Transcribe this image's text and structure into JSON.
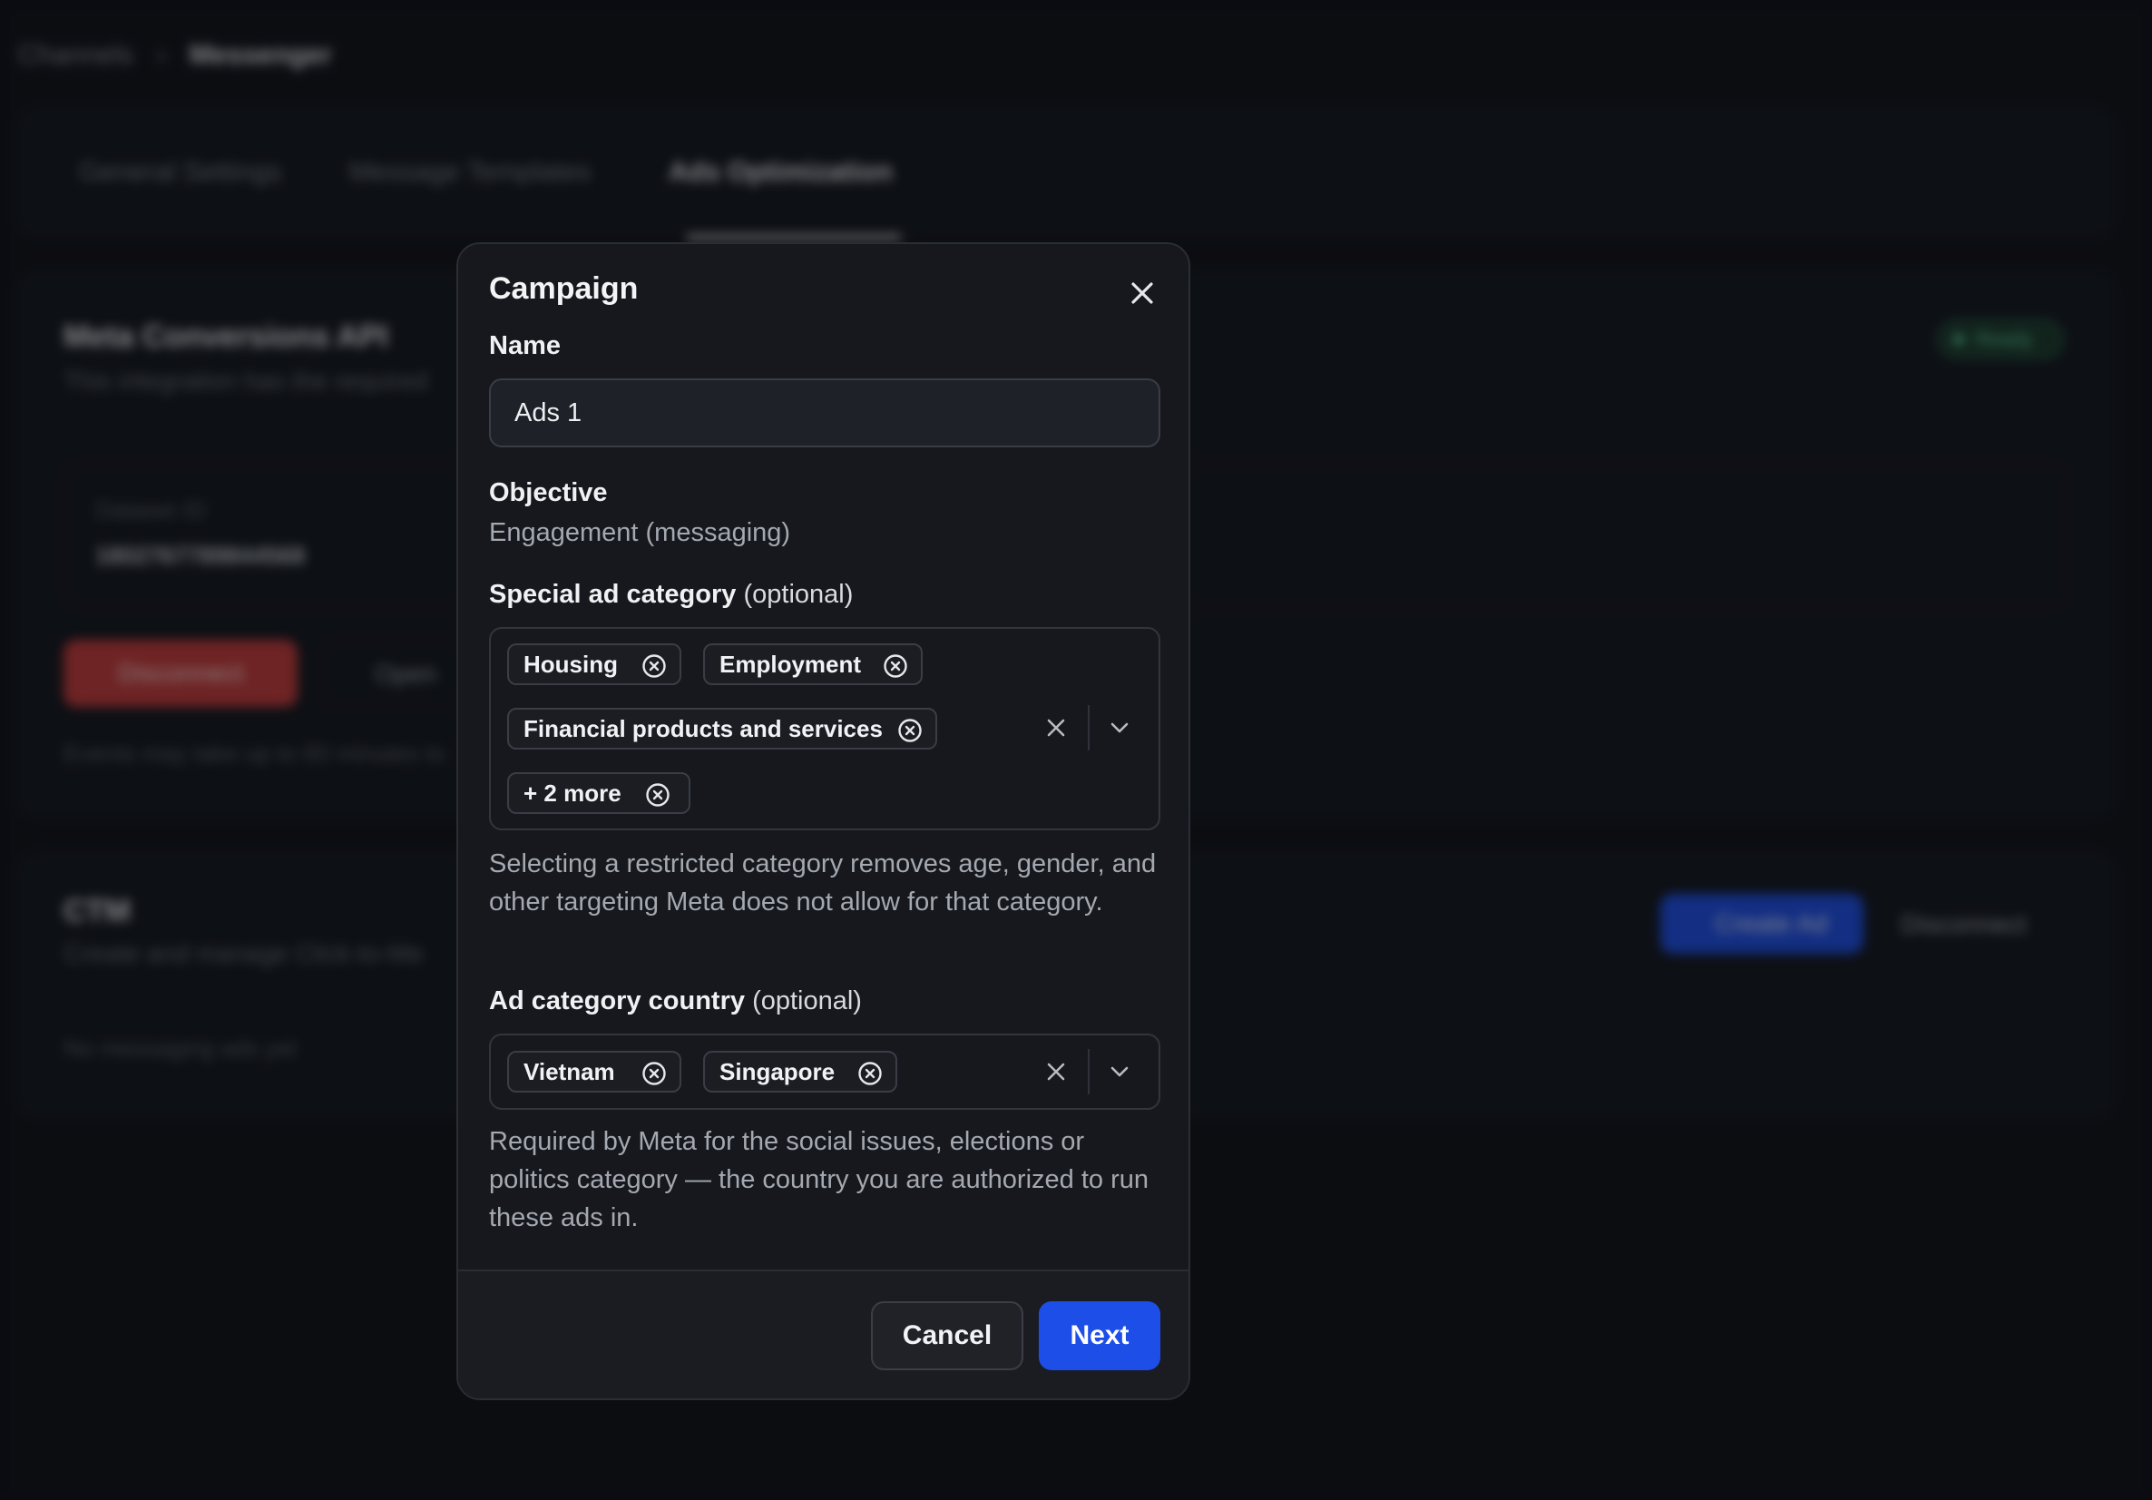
{
  "background": {
    "breadcrumb": [
      "Channels",
      "Messenger"
    ],
    "tabs": [
      "General Settings",
      "Message Templates",
      "Ads Optimization"
    ],
    "integration": {
      "title": "Meta Conversions API",
      "subtitle": "This integration has the required",
      "status": "Ready",
      "dataset_label": "Dataset ID",
      "dataset_value": "1802767789844568",
      "disconnect_label": "Disconnect",
      "open_label": "Open",
      "note": "Events may take up to 60 minutes to"
    },
    "ctm": {
      "title": "CTM",
      "subtitle": "Create and manage Click-to-Me",
      "create_label": "Create Ad",
      "disconnect_label": "Disconnect",
      "empty": "No messaging ads yet"
    }
  },
  "modal": {
    "title": "Campaign",
    "name_label": "Name",
    "name_value": "Ads 1",
    "objective_label": "Objective",
    "objective_value": "Engagement (messaging)",
    "special_label": "Special ad category",
    "special_optional": "(optional)",
    "special_chips": [
      "Housing",
      "Employment",
      "Financial products and services",
      "+ 2 more"
    ],
    "special_help": "Selecting a restricted category removes age, gender, and other targeting Meta does not allow for that category.",
    "country_label": "Ad category country",
    "country_optional": "(optional)",
    "country_chips": [
      "Vietnam",
      "Singapore"
    ],
    "country_help": "Required by Meta for the social issues, elections or politics category — the country you are authorized to run these ads in.",
    "cancel_label": "Cancel",
    "next_label": "Next"
  },
  "colors": {
    "accent": "#1d4ee8",
    "danger": "#c53b3b",
    "success": "#5fd39a"
  }
}
